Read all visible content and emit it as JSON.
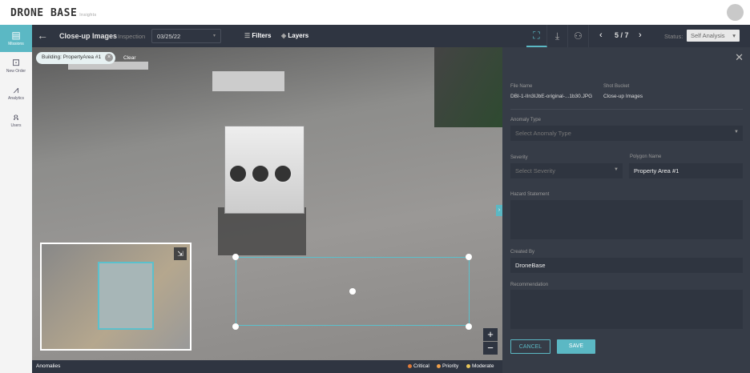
{
  "header": {
    "logo": "DRONE BASE",
    "logo_sub": "Insights"
  },
  "sidebar": {
    "items": [
      {
        "label": "Missions",
        "icon": "clipboard-icon"
      },
      {
        "label": "New Order",
        "icon": "inbox-icon"
      },
      {
        "label": "Analytics",
        "icon": "chart-icon"
      },
      {
        "label": "Users",
        "icon": "users-icon"
      }
    ]
  },
  "toolbar": {
    "title": "Close-up Images",
    "inspection_label": "Inspection",
    "inspection_date": "03/25/22",
    "filters": "Filters",
    "layers": "Layers",
    "pager": "5 / 7",
    "status_label": "Status:",
    "status_value": "Self Analysis"
  },
  "image": {
    "filter_chip": "Building: PropertyArea #1",
    "clear": "Clear"
  },
  "footer": {
    "anomalies": "Anomalies",
    "legend": [
      {
        "label": "Critical",
        "color": "#e07b39"
      },
      {
        "label": "Priority",
        "color": "#f0a04b"
      },
      {
        "label": "Moderate",
        "color": "#e8c65a"
      }
    ]
  },
  "panel": {
    "file_name_label": "File Name",
    "file_name": "DBI-1-IIn3IJbE-original-...1b30.JPG",
    "shot_bucket_label": "Shot Bucket",
    "shot_bucket": "Close-up Images",
    "anomaly_type_label": "Anomaly Type",
    "anomaly_type_placeholder": "Select Anomaly Type",
    "severity_label": "Severity",
    "severity_placeholder": "Select Severity",
    "polygon_name_label": "Polygon Name",
    "polygon_name": "Property Area #1",
    "hazard_label": "Hazard Statement",
    "created_by_label": "Created By",
    "created_by": "DroneBase",
    "recommendation_label": "Recommendation",
    "cancel": "CANCEL",
    "save": "SAVE"
  }
}
